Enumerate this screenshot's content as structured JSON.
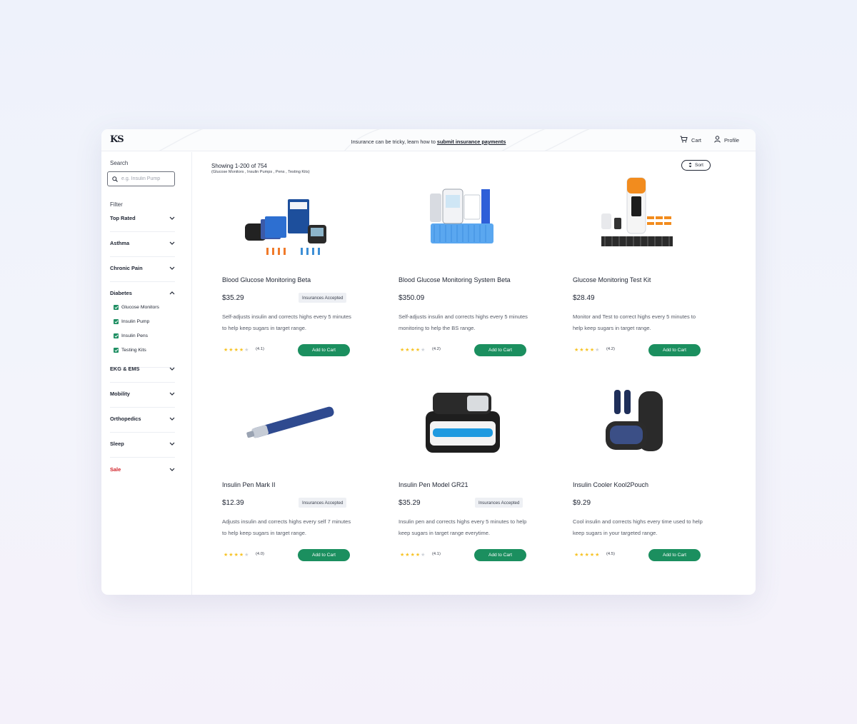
{
  "brand": {
    "logo_text": "KS"
  },
  "topbar": {
    "notice_prefix": "Insurance can be tricky, learn how to ",
    "notice_link": "submit insurance payments",
    "cart_label": "Cart",
    "profile_label": "Profile"
  },
  "sidebar": {
    "search_label": "Search",
    "search_placeholder": "e.g. Insulin Pump",
    "filter_label": "Filter",
    "groups": [
      {
        "label": "Top Rated",
        "expanded": false
      },
      {
        "label": "Asthma",
        "expanded": false
      },
      {
        "label": "Chronic Pain",
        "expanded": false
      },
      {
        "label": "Diabetes",
        "expanded": true,
        "options": [
          {
            "label": "Glucose Monitors",
            "checked": true
          },
          {
            "label": "Insulin Pump",
            "checked": true
          },
          {
            "label": "Insulin Pens",
            "checked": true
          },
          {
            "label": "Testing Kits",
            "checked": true
          }
        ]
      },
      {
        "label": "EKG & EMS",
        "expanded": false
      },
      {
        "label": "Mobility",
        "expanded": false
      },
      {
        "label": "Orthopedics",
        "expanded": false
      },
      {
        "label": "Sleep",
        "expanded": false
      },
      {
        "label": "Sale",
        "expanded": false,
        "highlight": "#d12027"
      }
    ]
  },
  "results": {
    "showing": "Showing 1-200 of 754",
    "applied_filters": "(Glucose Monitors , Insulin Pumps , Pens , Testing Kits)",
    "sort_label": "Sort"
  },
  "products": [
    {
      "name": "Blood Glucose Monitoring  Beta",
      "price": "$35.29",
      "badge": "Insurances Accepted",
      "desc": "Self-adjusts insulin and corrects highs every 5 minutes to help keep sugars in target range.",
      "rating_text": "(4.1)",
      "stars": 4.1,
      "cta": "Add to Cart",
      "icon": "glucose-kit-icon"
    },
    {
      "name": "Blood Glucose Monitoring System Beta",
      "price": "$350.09",
      "badge": "",
      "desc": "Self-adjusts insulin and corrects highs every 5 minutes monitoring to help the BS range.",
      "rating_text": "(4.2)",
      "stars": 4.2,
      "cta": "Add to Cart",
      "icon": "glucose-meter-icon"
    },
    {
      "name": "Glucose Monitoring Test Kit",
      "price": "$28.49",
      "badge": "",
      "desc": "Monitor and Test to correct highs every 5 minutes to help keep sugars in target range.",
      "rating_text": "(4.2)",
      "stars": 4.2,
      "cta": "Add to Cart",
      "icon": "test-kit-icon"
    },
    {
      "name": "Insulin Pen Mark II",
      "price": "$12.39",
      "badge": "Insurances Accepted",
      "desc": "Adjusts insulin and corrects highs every self 7 minutes to help keep sugars in target range.",
      "rating_text": "(4.0)",
      "stars": 4.0,
      "cta": "Add to Cart",
      "icon": "insulin-pen-icon"
    },
    {
      "name": "Insulin Pen Model GR21",
      "price": "$35.29",
      "badge": "Insurances Accepted",
      "desc": "Insulin pen and corrects highs every 5 minutes to help keep sugars in target range everytime.",
      "rating_text": "(4.1)",
      "stars": 4.1,
      "cta": "Add to Cart",
      "icon": "insulin-pen-case-icon"
    },
    {
      "name": "Insulin Cooler Kool2Pouch",
      "price": "$9.29",
      "badge": "",
      "desc": "Cool insulin and corrects highs every time used to help keep sugars in your targeted range.",
      "rating_text": "(4.5)",
      "stars": 4.5,
      "cta": "Add to Cart",
      "icon": "cooler-pouch-icon"
    }
  ],
  "colors": {
    "accent": "#1b8f5f",
    "sale": "#d12027",
    "star": "#f7c325"
  }
}
